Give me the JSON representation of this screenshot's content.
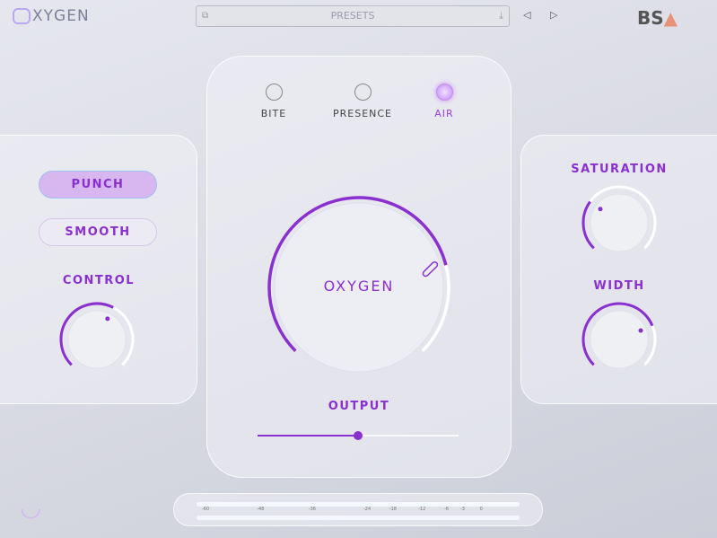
{
  "header": {
    "logo": "XYGEN",
    "presets": "PRESETS",
    "brand": "BS",
    "brand_mark": "▲",
    "prev": "◁",
    "next": "▷"
  },
  "modes": [
    {
      "label": "BITE",
      "active": false
    },
    {
      "label": "PRESENCE",
      "active": false
    },
    {
      "label": "AIR",
      "active": true
    }
  ],
  "left": {
    "punch": "PUNCH",
    "smooth": "SMOOTH",
    "control_label": "CONTROL",
    "control_value": 0.6
  },
  "center": {
    "knob_label": "OXYGEN",
    "knob_value": 0.78,
    "output_label": "OUTPUT",
    "output_value": 0.5
  },
  "right": {
    "saturation_label": "SATURATION",
    "saturation_value": 0.3,
    "width_label": "WIDTH",
    "width_value": 0.75
  },
  "meter": {
    "ticks": [
      "-60",
      "-48",
      "-36",
      "-24",
      "-18",
      "-12",
      "-6",
      "-3",
      "0"
    ]
  },
  "colors": {
    "accent": "#8a2fd0",
    "track": "#ffffff"
  }
}
